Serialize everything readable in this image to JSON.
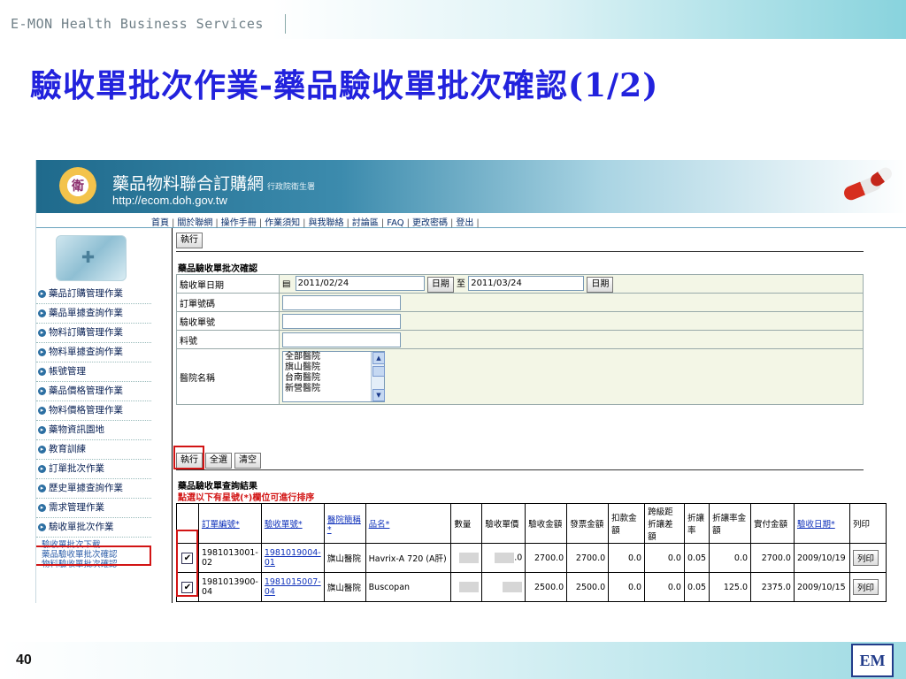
{
  "slide": {
    "brand": "E-MON Health Business Services",
    "title": "驗收單批次作業-藥品驗收單批次確認(1/2)",
    "page_number": "40",
    "logo_text": "EM"
  },
  "site": {
    "name": "藥品物料聯合訂購網",
    "sub": "行政院衛生署",
    "url": "http://ecom.doh.gov.tw",
    "logo_text": "衛",
    "nav": [
      "首頁",
      "關於聯網",
      "操作手冊",
      "作業須知",
      "與我聯絡",
      "討論區",
      "FAQ",
      "更改密碼",
      "登出"
    ]
  },
  "menu": {
    "items": [
      "藥品訂購管理作業",
      "藥品單據查詢作業",
      "物料訂購管理作業",
      "物料單據查詢作業",
      "帳號管理",
      "藥品價格管理作業",
      "物料價格管理作業",
      "藥物資訊園地",
      "教育訓練",
      "訂單批次作業",
      "歷史單據查詢作業",
      "需求管理作業",
      "驗收單批次作業"
    ],
    "sub_items": [
      "驗收單批次下載",
      "藥品驗收單批次確認",
      "物料驗收單批次確認"
    ]
  },
  "form": {
    "run_label": "執行",
    "title": "藥品驗收單批次確認",
    "fields": {
      "date_label": "驗收單日期",
      "date_from": "2011/02/24",
      "date_btn": "日期",
      "to": "至",
      "date_to": "2011/03/24",
      "order_label": "訂單號碼",
      "receipt_label": "驗收單號",
      "item_label": "料號",
      "hospital_label": "醫院名稱"
    },
    "hospitals": [
      "全部醫院",
      "旗山醫院",
      "台南醫院",
      "新營醫院"
    ],
    "buttons": [
      "執行",
      "全選",
      "清空"
    ]
  },
  "results": {
    "title": "藥品驗收單查詢結果",
    "note": "點選以下有星號(*)欄位可進行排序",
    "headers": [
      "",
      "訂單編號*",
      "驗收單號*",
      "醫院簡稱*",
      "品名*",
      "數量",
      "驗收單價",
      "驗收金額",
      "發票金額",
      "扣款金額",
      "跨級距折讓差額",
      "折讓率",
      "折讓率金額",
      "實付金額",
      "驗收日期*",
      "列印"
    ],
    "rows": [
      {
        "checked": "✔",
        "order": "1981013001-02",
        "receipt": "1981019004-01",
        "hospital": "旗山醫院",
        "product": "Havrix-A 720 (A肝)",
        "qty_suffix": "",
        "unit_price_suffix": ".0",
        "amount": "2700.0",
        "invoice": "2700.0",
        "deduct": "0.0",
        "diff": "0.0",
        "rate": "0.05",
        "rate_amount": "0.0",
        "paid": "2700.0",
        "date": "2009/10/19",
        "print": "列印"
      },
      {
        "checked": "✔",
        "order": "1981013900-04",
        "receipt": "1981015007-04",
        "hospital": "旗山醫院",
        "product": "Buscopan",
        "qty_suffix": "",
        "unit_price_suffix": "",
        "amount": "2500.0",
        "invoice": "2500.0",
        "deduct": "0.0",
        "diff": "0.0",
        "rate": "0.05",
        "rate_amount": "125.0",
        "paid": "2375.0",
        "date": "2009/10/15",
        "print": "列印"
      }
    ]
  }
}
